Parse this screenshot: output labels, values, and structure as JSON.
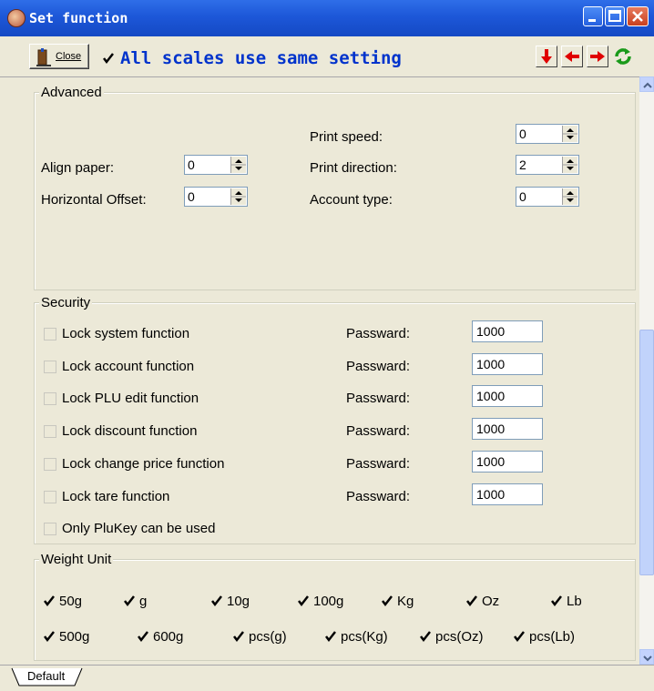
{
  "window": {
    "title": "Set function"
  },
  "toolbar": {
    "close_label": "Close",
    "same_setting_label": "All scales use same setting",
    "same_setting_checked": true
  },
  "advanced": {
    "title": "Advanced",
    "print_speed": {
      "label": "Print speed:",
      "value": "0"
    },
    "align_paper": {
      "label": "Align paper:",
      "value": "0"
    },
    "print_direction": {
      "label": "Print direction:",
      "value": "2"
    },
    "horizontal_offset": {
      "label": "Horizontal Offset:",
      "value": "0"
    },
    "account_type": {
      "label": "Account type:",
      "value": "0"
    }
  },
  "security": {
    "title": "Security",
    "password_label": "Passward:",
    "rows": [
      {
        "label": "Lock system function",
        "password": "1000"
      },
      {
        "label": "Lock account function",
        "password": "1000"
      },
      {
        "label": "Lock PLU edit function",
        "password": "1000"
      },
      {
        "label": "Lock discount function",
        "password": "1000"
      },
      {
        "label": "Lock change price function",
        "password": "1000"
      },
      {
        "label": "Lock tare function",
        "password": "1000"
      }
    ],
    "only_plukey": "Only PluKey can be used"
  },
  "weight_unit": {
    "title": "Weight Unit",
    "row1": [
      "50g",
      "g",
      "10g",
      "100g",
      "Kg",
      "Oz",
      "Lb"
    ],
    "row2": [
      "500g",
      "600g",
      "pcs(g)",
      "pcs(Kg)",
      "pcs(Oz)",
      "pcs(Lb)"
    ]
  },
  "tabs": {
    "default_label": "Default"
  },
  "colors": {
    "title_bar": "#1d57d8",
    "accent_text": "#0033cc",
    "arrow_red": "#e00000",
    "refresh_green": "#1a9a1a"
  }
}
